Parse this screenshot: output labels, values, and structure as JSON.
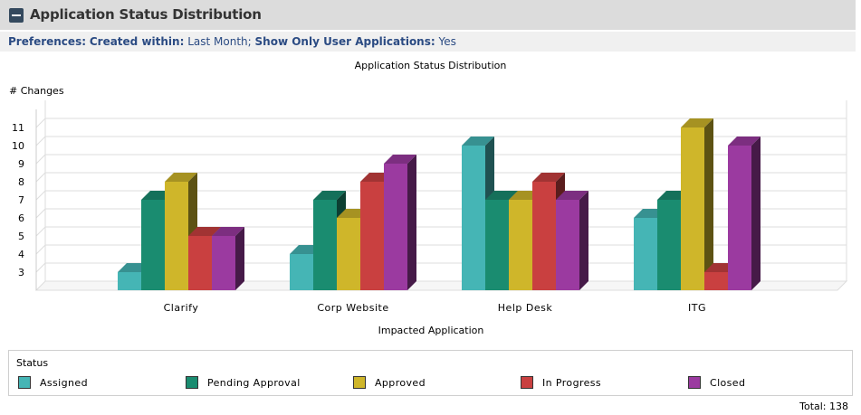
{
  "panel": {
    "title": "Application Status Distribution",
    "preferences": {
      "label": "Preferences:",
      "created_label": "Created within:",
      "created_value": "Last Month;",
      "user_apps_label": "Show Only User Applications:",
      "user_apps_value": "Yes"
    }
  },
  "legend": {
    "title": "Status",
    "items": [
      {
        "label": "Assigned",
        "color": "#45b5b5"
      },
      {
        "label": "Pending Approval",
        "color": "#1a8c70"
      },
      {
        "label": "Approved",
        "color": "#cfb62a"
      },
      {
        "label": "In Progress",
        "color": "#c94040"
      },
      {
        "label": "Closed",
        "color": "#9b3aa0"
      }
    ]
  },
  "footer": {
    "total": "Total: 138"
  },
  "chart_data": {
    "type": "bar",
    "title": "Application Status Distribution",
    "xlabel": "Impacted Application",
    "ylabel": "# Changes",
    "categories": [
      "Clarify",
      "Corp Website",
      "Help Desk",
      "ITG"
    ],
    "series": [
      {
        "name": "Assigned",
        "color": "#45b5b5",
        "values": [
          3,
          4,
          10,
          6
        ]
      },
      {
        "name": "Pending Approval",
        "color": "#1a8c70",
        "values": [
          7,
          7,
          7,
          7
        ]
      },
      {
        "name": "Approved",
        "color": "#cfb62a",
        "values": [
          8,
          6,
          7,
          11
        ]
      },
      {
        "name": "In Progress",
        "color": "#c94040",
        "values": [
          5,
          8,
          8,
          3
        ]
      },
      {
        "name": "Closed",
        "color": "#9b3aa0",
        "values": [
          5,
          9,
          7,
          10
        ]
      }
    ],
    "yticks": [
      3,
      4,
      5,
      6,
      7,
      8,
      9,
      10,
      11
    ],
    "ylim": [
      2,
      12
    ],
    "grid": true,
    "style": "3d",
    "legend_position": "bottom"
  }
}
